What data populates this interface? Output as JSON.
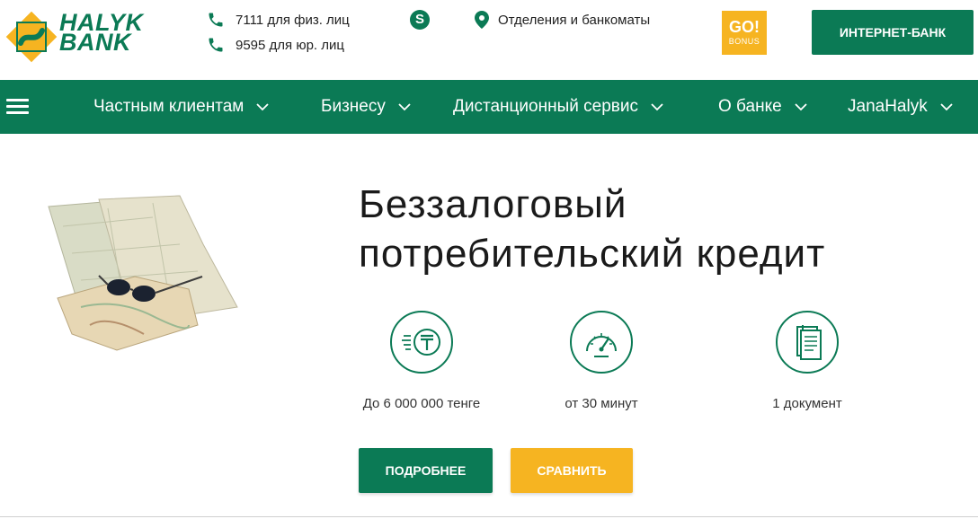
{
  "header": {
    "logo": {
      "line1": "HALYK",
      "line2": "BANK"
    },
    "phones": [
      {
        "number": "7111",
        "label": "для физ. лиц",
        "icon": "phone-icon"
      },
      {
        "number": "9595",
        "label": "для юр. лиц",
        "icon": "phone-icon"
      }
    ],
    "skype_icon": "skype-icon",
    "skype_glyph": "S",
    "branches_label": "Отделения и банкоматы",
    "gobonus": {
      "line1": "GO!",
      "line2": "BONUS"
    },
    "internet_bank_label": "ИНТЕРНЕТ-БАНК"
  },
  "nav": {
    "menu_icon": "hamburger-icon",
    "items": [
      {
        "label": "Частным клиентам"
      },
      {
        "label": "Бизнесу"
      },
      {
        "label": "Дистанционный сервис"
      },
      {
        "label": "О банке"
      },
      {
        "label": "JanaHalyk"
      }
    ]
  },
  "hero": {
    "title_line1": "Беззалоговый",
    "title_line2": "потребительский кредит",
    "features": [
      {
        "icon": "tenge-coin-icon",
        "label": "До 6 000 000 тенге"
      },
      {
        "icon": "speedometer-icon",
        "label": "от 30 минут"
      },
      {
        "icon": "document-icon",
        "label": "1 документ"
      }
    ],
    "more_button": "ПОДРОБНЕЕ",
    "compare_button": "СРАВНИТЬ"
  },
  "colors": {
    "brand_green": "#0b7a55",
    "accent_yellow": "#f6b421",
    "text_dark": "#1a1a1a"
  }
}
